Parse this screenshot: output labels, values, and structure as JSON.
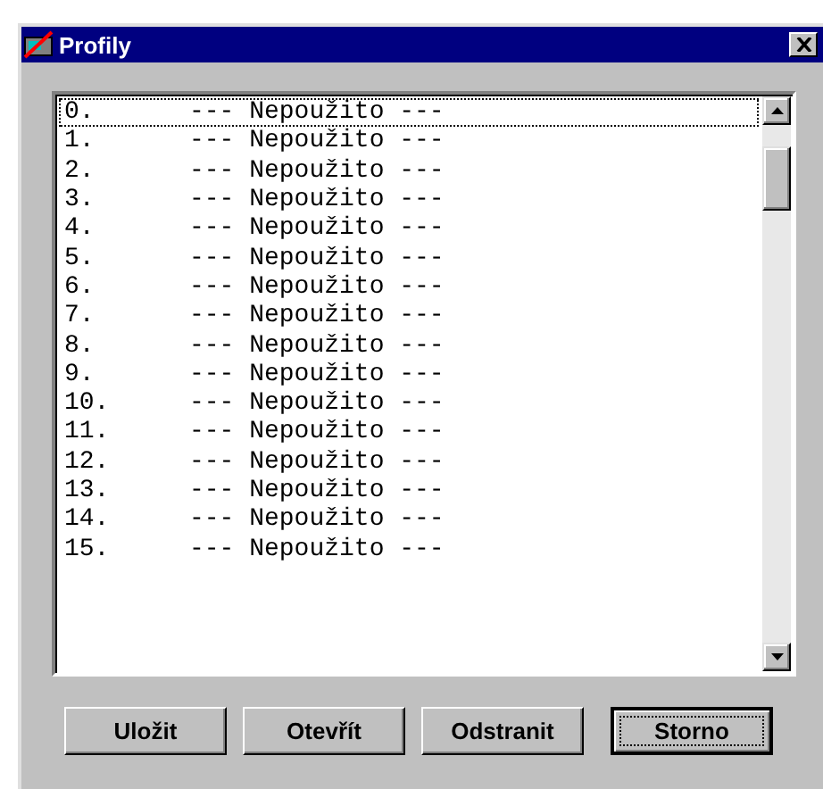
{
  "window": {
    "title": "Profily"
  },
  "list": {
    "rows": [
      {
        "number": "0.",
        "name": "--- Nepoužito ---",
        "focused": true
      },
      {
        "number": "1.",
        "name": "--- Nepoužito ---",
        "focused": false
      },
      {
        "number": "2.",
        "name": "--- Nepoužito ---",
        "focused": false
      },
      {
        "number": "3.",
        "name": "--- Nepoužito ---",
        "focused": false
      },
      {
        "number": "4.",
        "name": "--- Nepoužito ---",
        "focused": false
      },
      {
        "number": "5.",
        "name": "--- Nepoužito ---",
        "focused": false
      },
      {
        "number": "6.",
        "name": "--- Nepoužito ---",
        "focused": false
      },
      {
        "number": "7.",
        "name": "--- Nepoužito ---",
        "focused": false
      },
      {
        "number": "8.",
        "name": "--- Nepoužito ---",
        "focused": false
      },
      {
        "number": "9.",
        "name": "--- Nepoužito ---",
        "focused": false
      },
      {
        "number": "10.",
        "name": "--- Nepoužito ---",
        "focused": false
      },
      {
        "number": "11.",
        "name": "--- Nepoužito ---",
        "focused": false
      },
      {
        "number": "12.",
        "name": "--- Nepoužito ---",
        "focused": false
      },
      {
        "number": "13.",
        "name": "--- Nepoužito ---",
        "focused": false
      },
      {
        "number": "14.",
        "name": "--- Nepoužito ---",
        "focused": false
      },
      {
        "number": "15.",
        "name": "--- Nepoužito ---",
        "focused": false
      }
    ]
  },
  "buttons": [
    {
      "label": "Uložit",
      "default": false
    },
    {
      "label": "Otevřít",
      "default": false
    },
    {
      "label": "Odstranit",
      "default": false
    },
    {
      "label": "Storno",
      "default": true
    }
  ]
}
